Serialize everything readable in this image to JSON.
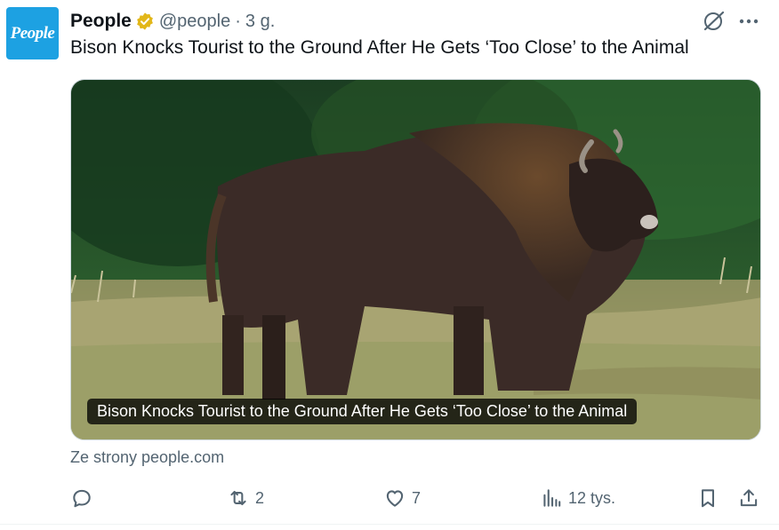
{
  "tweet": {
    "author_name": "People",
    "avatar_text": "People",
    "handle": "@people",
    "separator": "·",
    "time": "3 g.",
    "text": "Bison Knocks Tourist to the Ground After He Gets ‘Too Close’ to the Animal"
  },
  "card": {
    "caption": "Bison Knocks Tourist to the Ground After He Gets ‘Too Close’ to the Animal",
    "source": "Ze strony people.com"
  },
  "actions": {
    "reply_count": "",
    "retweet_count": "2",
    "like_count": "7",
    "views_count": "12 tys."
  },
  "colors": {
    "avatar_bg": "#1da1e2",
    "verified_gold": "#e2b719",
    "muted_text": "#536471"
  },
  "icons": [
    "verified-badge-icon",
    "grok-icon",
    "more-icon",
    "reply-icon",
    "retweet-icon",
    "like-icon",
    "views-icon",
    "bookmark-icon",
    "share-icon"
  ]
}
